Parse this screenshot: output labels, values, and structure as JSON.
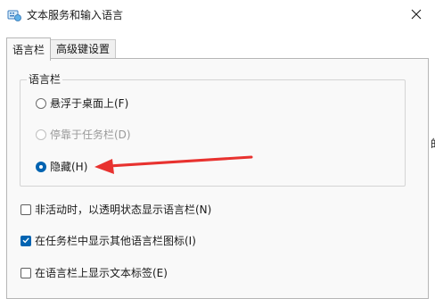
{
  "window": {
    "title": "文本服务和输入语言",
    "app_icon": "keyboard-globe-icon",
    "close_icon": "close-icon"
  },
  "tabs": [
    {
      "label": "语言栏",
      "active": true
    },
    {
      "label": "高级键设置",
      "active": false
    }
  ],
  "language_bar_group": {
    "legend": "语言栏",
    "options": [
      {
        "label": "悬浮于桌面上(F)",
        "checked": false,
        "enabled": true
      },
      {
        "label": "停靠于任务栏(D)",
        "checked": false,
        "enabled": false
      },
      {
        "label": "隐藏(H)",
        "checked": true,
        "enabled": true
      }
    ]
  },
  "checkboxes": [
    {
      "label": "非活动时，以透明状态显示语言栏(N)",
      "checked": false
    },
    {
      "label": "在任务栏中显示其他语言栏图标(I)",
      "checked": true
    },
    {
      "label": "在语言栏上显示文本标签(E)",
      "checked": false
    }
  ],
  "annotation": {
    "color": "#e8322f",
    "icon": "red-arrow-icon"
  },
  "accent_color": "#0063b1",
  "background_window_edge_text": "的"
}
